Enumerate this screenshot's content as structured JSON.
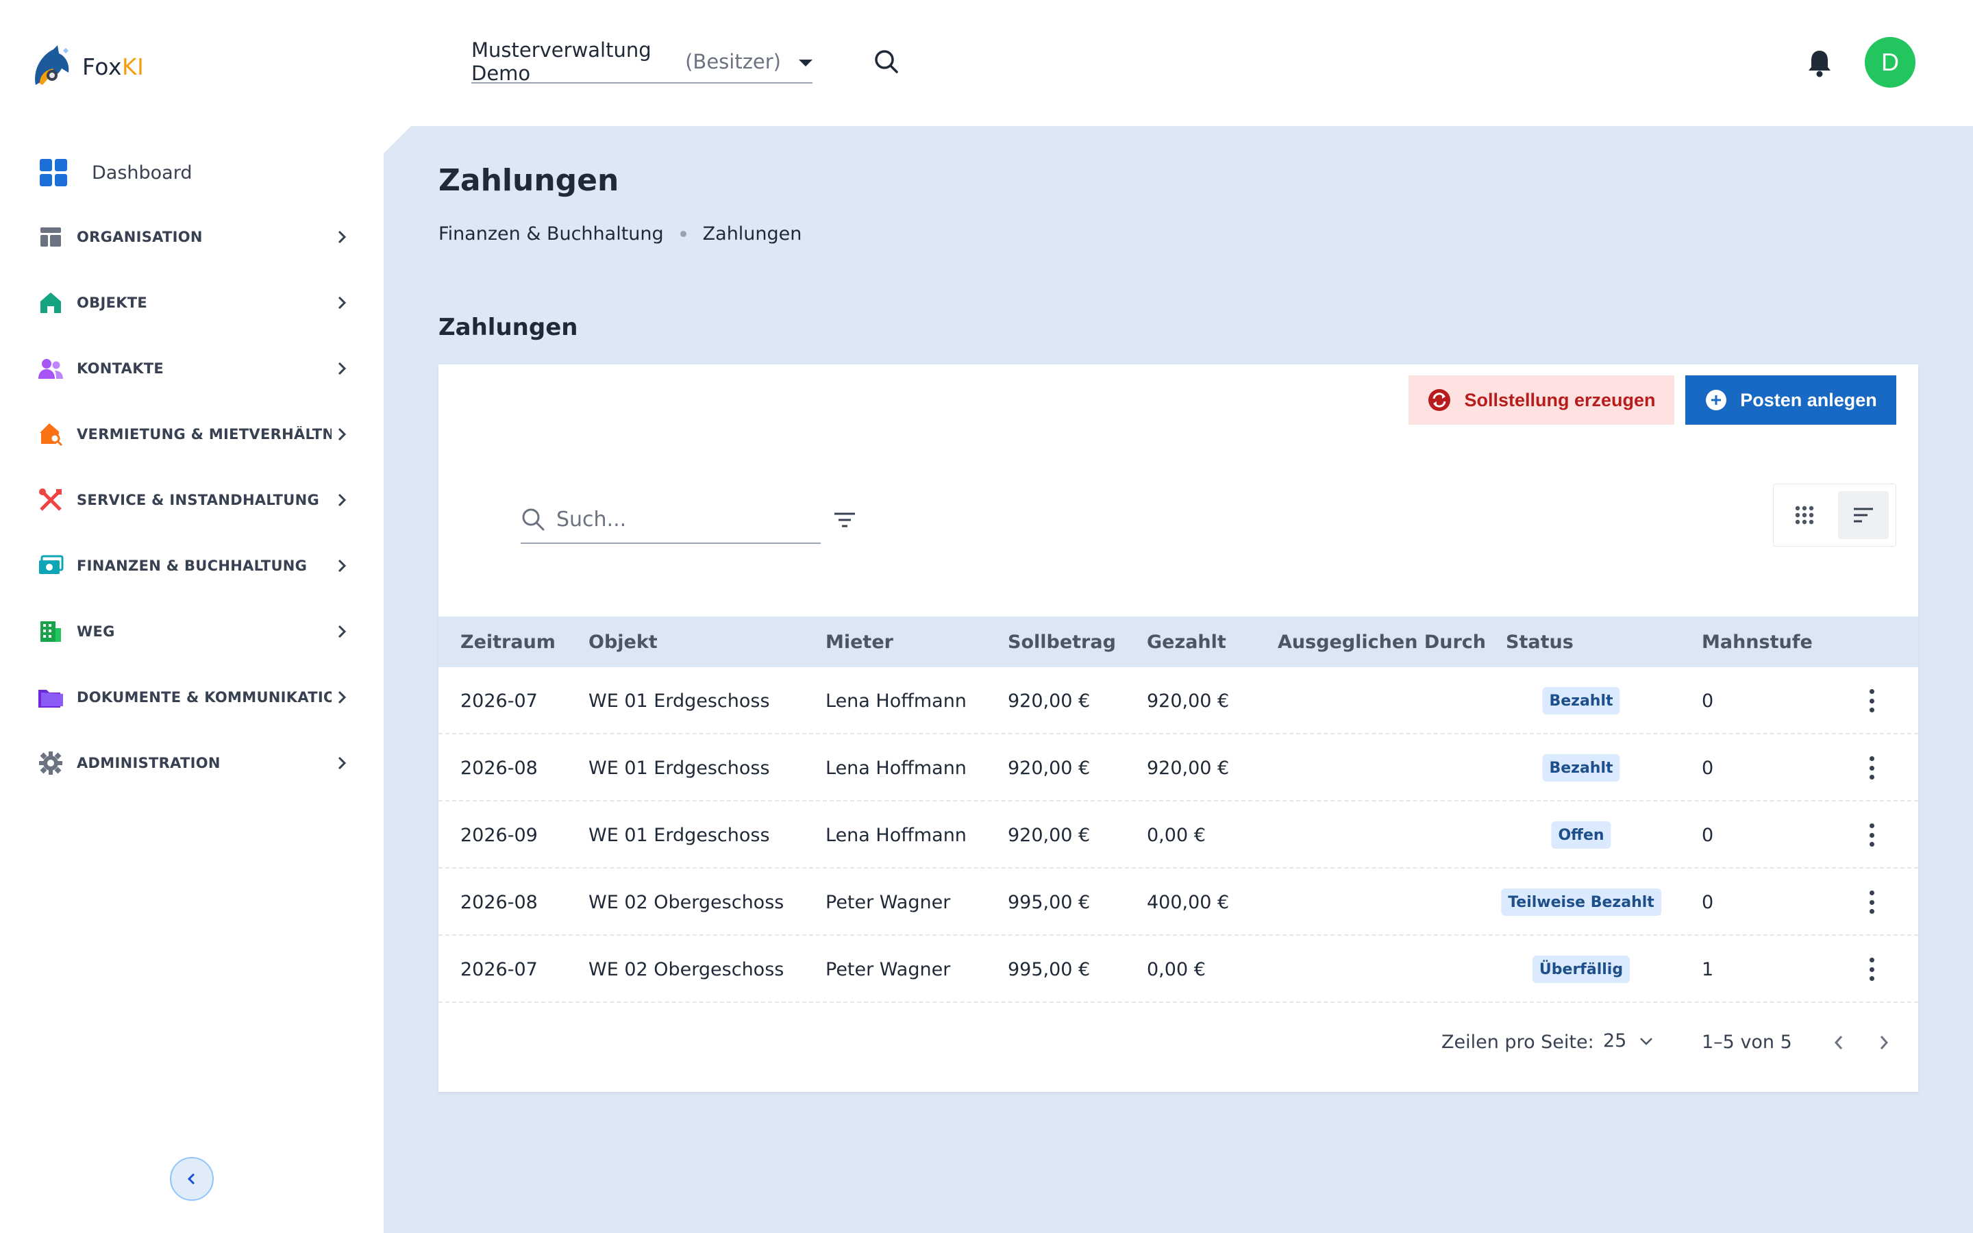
{
  "brand": {
    "name_main": "Fox",
    "name_accent": "KI"
  },
  "header": {
    "org_name": "Musterverwaltung Demo",
    "org_role": "(Besitzer)",
    "avatar_initial": "D"
  },
  "sidebar": {
    "dashboard": "Dashboard",
    "items": [
      {
        "label": "ORGANISATION",
        "icon": "layout-icon",
        "color": "#6b7280"
      },
      {
        "label": "OBJEKTE",
        "icon": "house-icon",
        "color": "#16a37f"
      },
      {
        "label": "KONTAKTE",
        "icon": "people-icon",
        "color": "#a855f7"
      },
      {
        "label": "VERMIETUNG & MIETVERHÄLTN...",
        "icon": "house-search-icon",
        "color": "#f97316"
      },
      {
        "label": "SERVICE & INSTANDHALTUNG",
        "icon": "tools-icon",
        "color": "#ef4444"
      },
      {
        "label": "FINANZEN & BUCHHALTUNG",
        "icon": "money-icon",
        "color": "#0ea5b7"
      },
      {
        "label": "WEG",
        "icon": "building-icon",
        "color": "#16a34a"
      },
      {
        "label": "DOKUMENTE & KOMMUNIKATION",
        "icon": "folder-icon",
        "color": "#7c3aed"
      },
      {
        "label": "ADMINISTRATION",
        "icon": "gear-icon",
        "color": "#6b7280"
      }
    ]
  },
  "page": {
    "title": "Zahlungen",
    "breadcrumb": [
      "Finanzen & Buchhaltung",
      "Zahlungen"
    ],
    "section_title": "Zahlungen"
  },
  "toolbar": {
    "soll_label": "Sollstellung erzeugen",
    "posten_label": "Posten anlegen",
    "search_placeholder": "Such..."
  },
  "table": {
    "columns": [
      "Zeitraum",
      "Objekt",
      "Mieter",
      "Sollbetrag",
      "Gezahlt",
      "Ausgeglichen Durch",
      "Status",
      "Mahnstufe"
    ],
    "rows": [
      {
        "zeitraum": "2026-07",
        "objekt": "WE 01 Erdgeschoss",
        "mieter": "Lena Hoffmann",
        "soll": "920,00 €",
        "gezahlt": "920,00 €",
        "ausgeglichen": "",
        "status": "Bezahlt",
        "mahnstufe": "0"
      },
      {
        "zeitraum": "2026-08",
        "objekt": "WE 01 Erdgeschoss",
        "mieter": "Lena Hoffmann",
        "soll": "920,00 €",
        "gezahlt": "920,00 €",
        "ausgeglichen": "",
        "status": "Bezahlt",
        "mahnstufe": "0"
      },
      {
        "zeitraum": "2026-09",
        "objekt": "WE 01 Erdgeschoss",
        "mieter": "Lena Hoffmann",
        "soll": "920,00 €",
        "gezahlt": "0,00 €",
        "ausgeglichen": "",
        "status": "Offen",
        "mahnstufe": "0"
      },
      {
        "zeitraum": "2026-08",
        "objekt": "WE 02 Obergeschoss",
        "mieter": "Peter Wagner",
        "soll": "995,00 €",
        "gezahlt": "400,00 €",
        "ausgeglichen": "",
        "status": "Teilweise Bezahlt",
        "mahnstufe": "0"
      },
      {
        "zeitraum": "2026-07",
        "objekt": "WE 02 Obergeschoss",
        "mieter": "Peter Wagner",
        "soll": "995,00 €",
        "gezahlt": "0,00 €",
        "ausgeglichen": "",
        "status": "Überfällig",
        "mahnstufe": "1"
      }
    ]
  },
  "pagination": {
    "rows_per_page_label": "Zeilen pro Seite:",
    "rows_per_page": "25",
    "range": "1–5 von 5"
  }
}
